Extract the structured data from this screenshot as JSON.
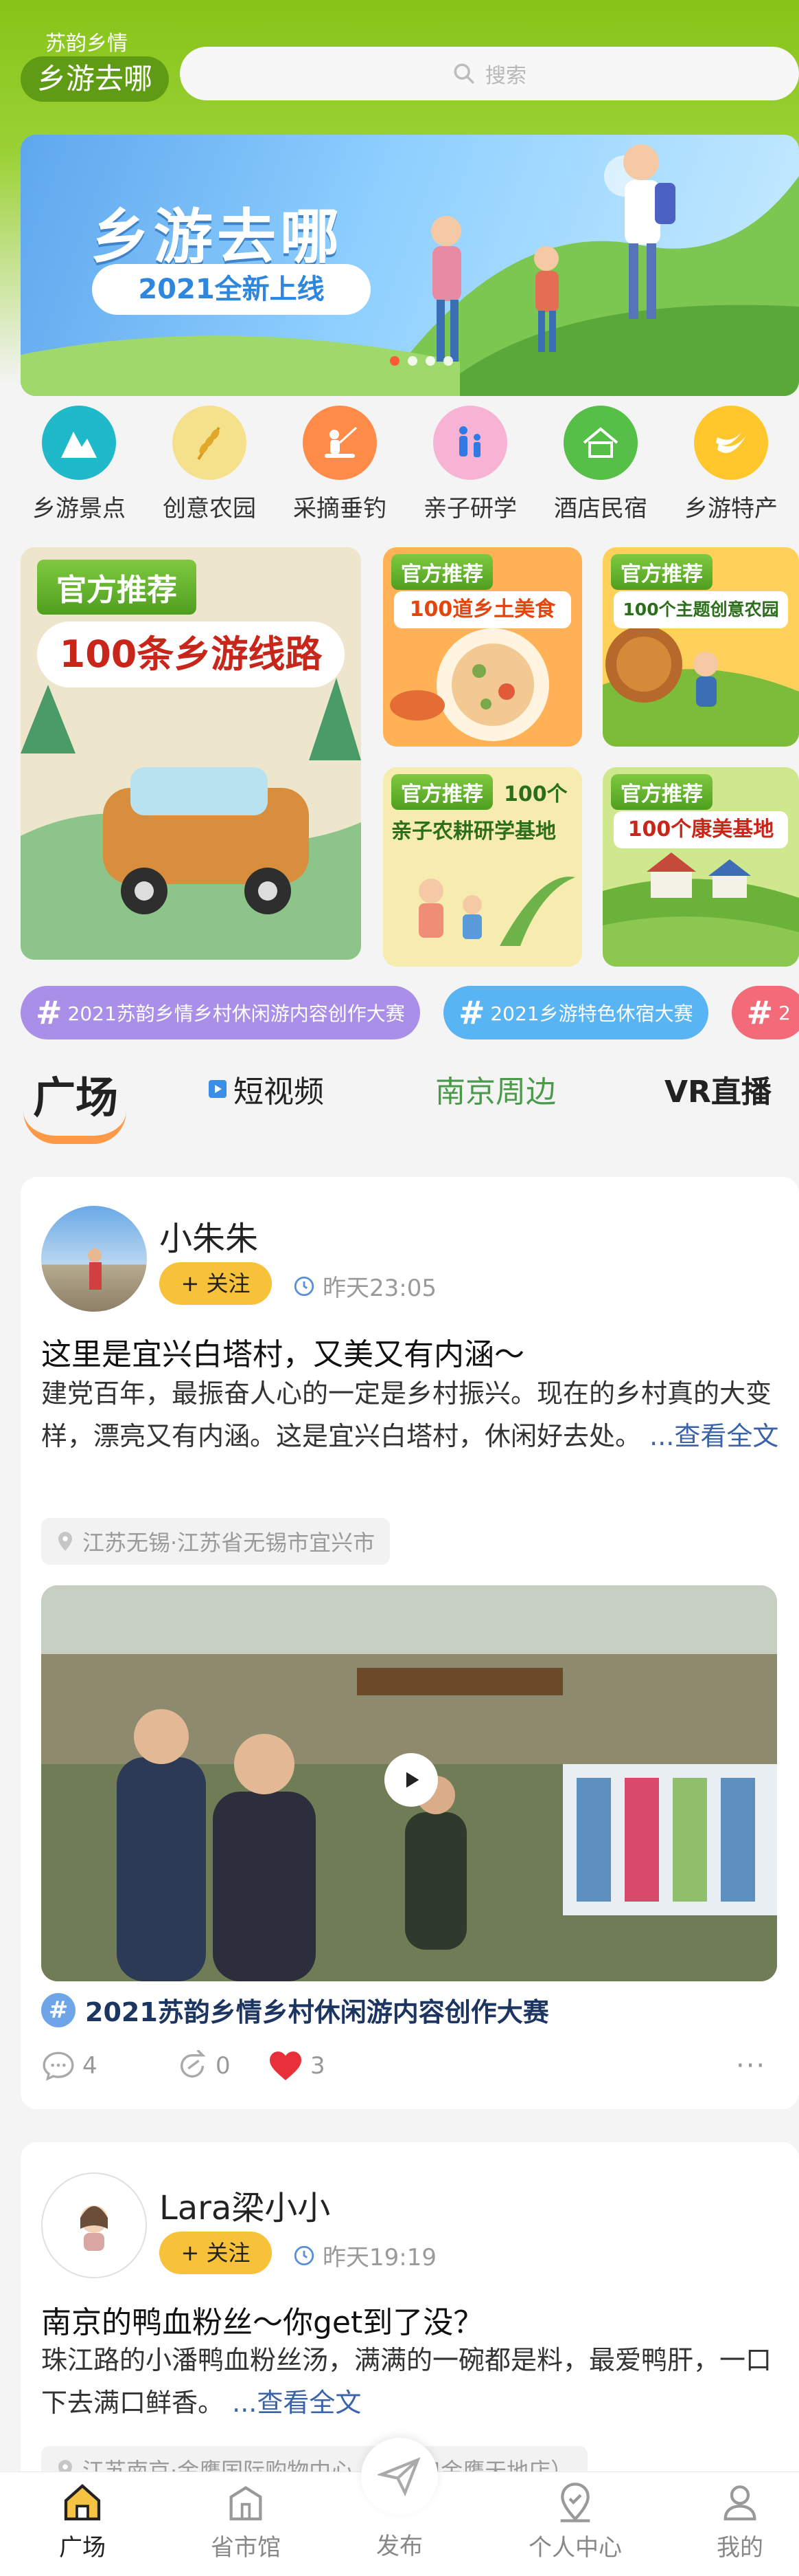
{
  "header": {
    "brand_small": "苏韵乡情",
    "brand_main": "乡游去哪",
    "search_placeholder": "搜索"
  },
  "banner": {
    "title": "乡游去哪",
    "subtitle": "2021全新上线",
    "dots": 4,
    "active_dot": 1
  },
  "categories": [
    {
      "label": "乡游景点",
      "color": "#1fb9c9",
      "icon": "mountain-icon"
    },
    {
      "label": "创意农园",
      "color": "#f5e18b",
      "icon": "wheat-icon"
    },
    {
      "label": "采摘垂钓",
      "color": "#ff8b49",
      "icon": "fishing-icon"
    },
    {
      "label": "亲子研学",
      "color": "#f7b3d4",
      "icon": "family-icon"
    },
    {
      "label": "酒店民宿",
      "color": "#56bf47",
      "icon": "house-icon"
    },
    {
      "label": "乡游特产",
      "color": "#ffc72b",
      "icon": "banana-icon"
    }
  ],
  "promos": {
    "main": {
      "badge": "官方推荐",
      "title": "100条乡游线路"
    },
    "food": {
      "badge": "官方推荐",
      "title": "100道乡土美食"
    },
    "farm": {
      "badge": "官方推荐",
      "title": "100个主题创意农园"
    },
    "study": {
      "badge": "官方推荐",
      "title_line1": "100个",
      "title_line2": "亲子农耕研学基地"
    },
    "health": {
      "badge": "官方推荐",
      "title": "100个康美基地"
    }
  },
  "topics": [
    {
      "label": "2021苏韵乡情乡村休闲游内容创作大赛",
      "color": "#a98fe8"
    },
    {
      "label": "2021乡游特色休宿大赛",
      "color": "#59b4f3"
    },
    {
      "label": "2",
      "color": "#f36a79"
    }
  ],
  "tabs": {
    "square": "广场",
    "short_video": "短视频",
    "nanjing": "南京周边",
    "vr": "VR直播"
  },
  "posts": [
    {
      "username": "小朱朱",
      "follow": "+ 关注",
      "time": "昨天23:05",
      "title": "这里是宜兴白塔村，又美又有内涵～",
      "body": "建党百年，最振奋人心的一定是乡村振兴。现在的乡村真的大变样，漂亮又有内涵。这是宜兴白塔村，休闲好去处。",
      "more": "...查看全文",
      "location": "江苏无锡·江苏省无锡市宜兴市",
      "tag": "2021苏韵乡情乡村休闲游内容创作大赛",
      "comments": "4",
      "shares": "0",
      "likes": "3"
    },
    {
      "username": "Lara梁小小",
      "follow": "+ 关注",
      "time": "昨天19:19",
      "title": "南京的鸭血粉丝～你get到了没？",
      "body": "珠江路的小潘鸭血粉丝汤，满满的一碗都是料，最爱鸭肝，一口下去满口鲜香。",
      "more": "...查看全文",
      "location": "江苏南京·金鹰国际购物中心（新街口金鹰天地店）"
    }
  ],
  "bottom_nav": [
    {
      "label": "广场",
      "icon": "home-icon"
    },
    {
      "label": "省市馆",
      "icon": "building-icon"
    },
    {
      "label": "发布",
      "icon": "send-icon"
    },
    {
      "label": "个人中心",
      "icon": "location-pin-icon"
    },
    {
      "label": "我的",
      "icon": "person-icon"
    }
  ]
}
